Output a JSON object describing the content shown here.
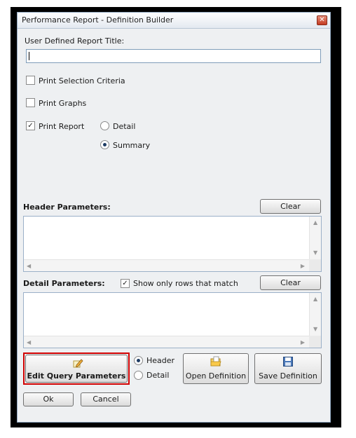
{
  "window": {
    "title": "Performance Report - Definition Builder",
    "close_glyph": "✕"
  },
  "report_title": {
    "label": "User Defined Report Title:",
    "value": ""
  },
  "options": {
    "print_selection_criteria": {
      "label": "Print Selection Criteria",
      "checked": false
    },
    "print_graphs": {
      "label": "Print Graphs",
      "checked": false
    },
    "print_report": {
      "label": "Print Report",
      "checked": true
    },
    "detail_radio": {
      "label": "Detail",
      "selected": false
    },
    "summary_radio": {
      "label": "Summary",
      "selected": true
    },
    "check_glyph": "✓"
  },
  "header_parameters": {
    "label": "Header Parameters:",
    "clear_label": "Clear"
  },
  "detail_parameters": {
    "label": "Detail Parameters:",
    "show_only_label": "Show only rows that match",
    "show_only_checked": true,
    "clear_label": "Clear"
  },
  "scroll_arrows": {
    "up": "▲",
    "down": "▼",
    "left": "◀",
    "right": "▶"
  },
  "bottom": {
    "edit_query_label": "Edit Query Parameters",
    "header_radio": {
      "label": "Header",
      "selected": true
    },
    "detail_radio": {
      "label": "Detail",
      "selected": false
    },
    "open_definition_label": "Open Definition",
    "save_definition_label": "Save Definition",
    "ok_label": "Ok",
    "cancel_label": "Cancel"
  },
  "colors": {
    "highlight": "#d00000",
    "close": "#c43b22"
  }
}
